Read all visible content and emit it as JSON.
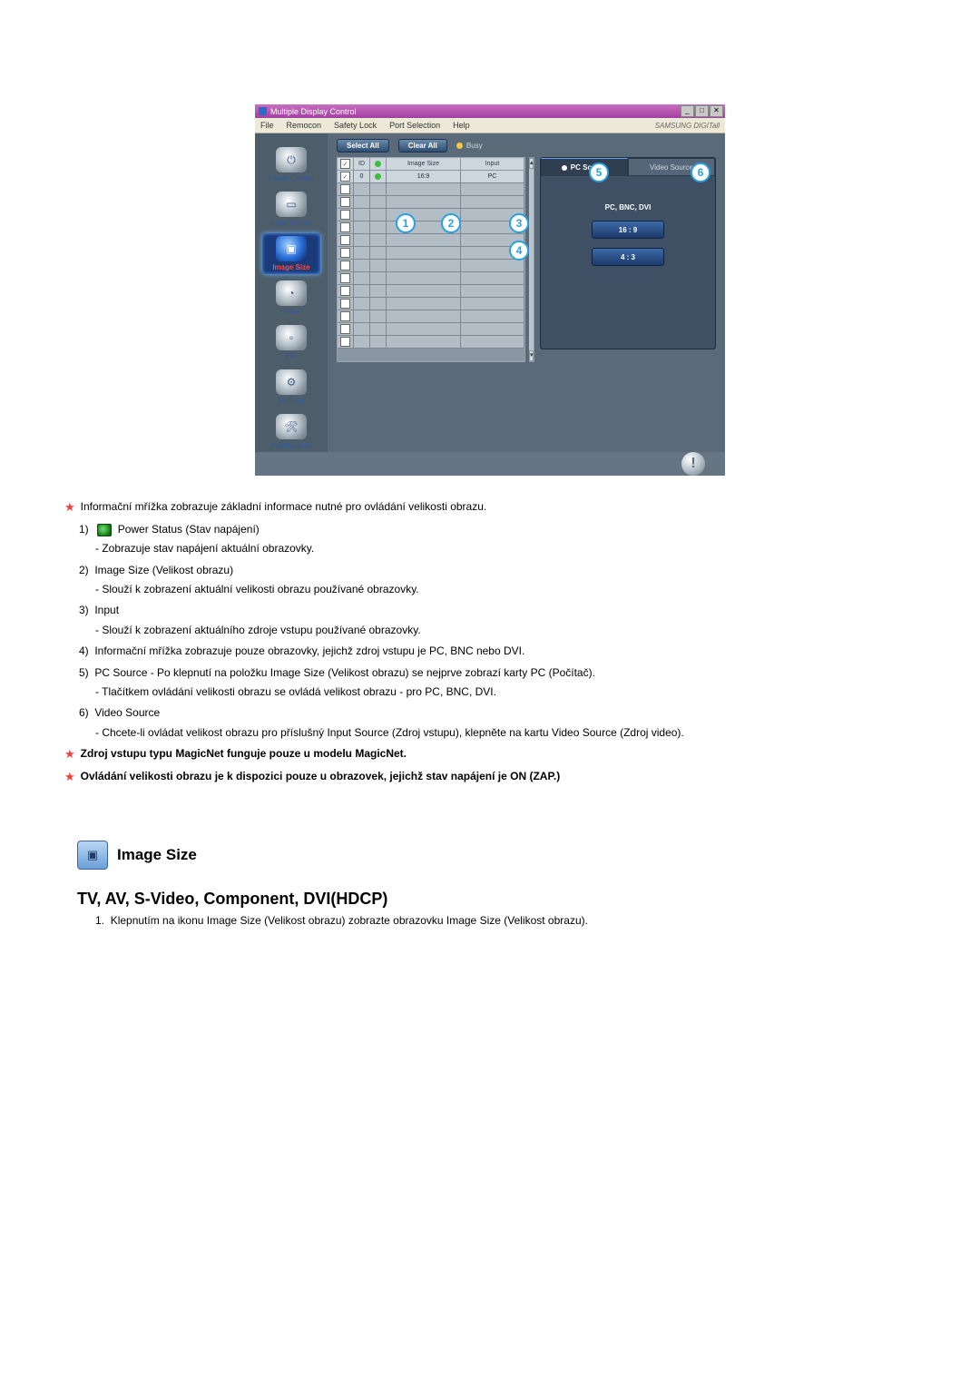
{
  "window": {
    "title": "Multiple Display Control",
    "menus": [
      "File",
      "Remocon",
      "Safety Lock",
      "Port Selection",
      "Help"
    ],
    "brand": "SAMSUNG DIGITall"
  },
  "sidebar": {
    "items": [
      {
        "label": "Power Control"
      },
      {
        "label": "Input Source"
      },
      {
        "label": "Image Size"
      },
      {
        "label": "Time"
      },
      {
        "label": "PIP"
      },
      {
        "label": "Settings"
      },
      {
        "label": "Maintenance"
      }
    ]
  },
  "toolbar": {
    "select_all": "Select All",
    "clear_all": "Clear All",
    "busy": "Busy"
  },
  "grid": {
    "headers": {
      "chk": "☑",
      "id": "ID",
      "pw": "",
      "size": "Image Size",
      "input": "Input"
    },
    "row": {
      "id": "0",
      "size": "16:9",
      "input": "PC"
    }
  },
  "right": {
    "tab_pc": "PC Source",
    "tab_video": "Video Source",
    "heading": "PC, BNC, DVI",
    "btn1": "16 : 9",
    "btn2": "4 : 3"
  },
  "callouts": {
    "1": "1",
    "2": "2",
    "3": "3",
    "4": "4",
    "5": "5",
    "6": "6"
  },
  "text": {
    "intro": "Informační mřížka zobrazuje základní informace nutné pro ovládání velikosti obrazu.",
    "i1_t": "Power Status (Stav napájení)",
    "i1_d": "- Zobrazuje stav napájení aktuální obrazovky.",
    "i2_t": "Image Size (Velikost obrazu)",
    "i2_d": "- Slouží k zobrazení aktuální velikosti obrazu používané obrazovky.",
    "i3_t": "Input",
    "i3_d": "- Slouží k zobrazení aktuálního zdroje vstupu používané obrazovky.",
    "i4": "Informační mřížka zobrazuje pouze obrazovky, jejichž zdroj vstupu je PC, BNC nebo DVI.",
    "i5a": "PC Source - Po klepnutí na položku Image Size (Velikost obrazu) se nejprve zobrazí karty PC (Počítač).",
    "i5b": "- Tlačítkem ovládání velikosti obrazu se ovládá velikost obrazu - pro PC, BNC, DVI.",
    "i6_t": "Video Source",
    "i6_d": "- Chcete-li ovládat velikost obrazu pro příslušný Input Source (Zdroj vstupu), klepněte na kartu Video Source (Zdroj video).",
    "note1": "Zdroj vstupu typu MagicNet funguje pouze u modelu MagicNet.",
    "note2": "Ovládání velikosti obrazu je k dispozici pouze u obrazovek, jejichž stav napájení je ON (ZAP.)"
  },
  "section2": {
    "title": "Image Size",
    "subtitle": "TV, AV, S-Video, Component, DVI(HDCP)",
    "li1": "Klepnutím na ikonu Image Size (Velikost obrazu) zobrazte obrazovku Image Size (Velikost obrazu)."
  }
}
